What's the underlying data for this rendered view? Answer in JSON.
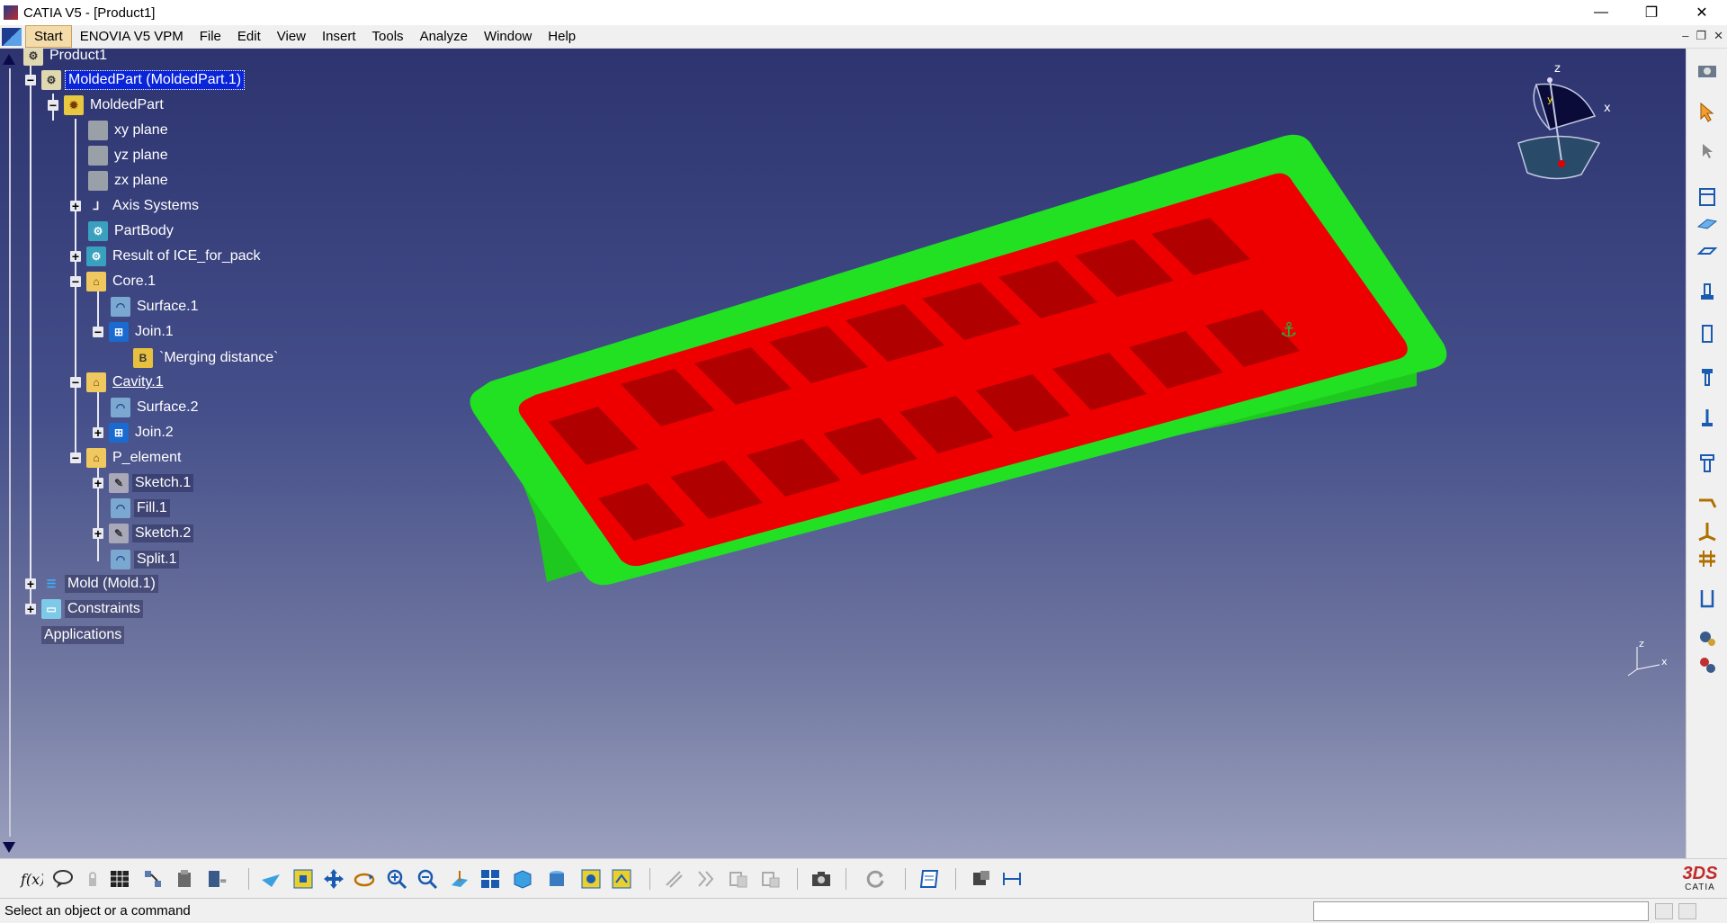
{
  "window": {
    "title": "CATIA V5 - [Product1]",
    "controls": {
      "minimize": "—",
      "maximize": "❐",
      "close": "✕"
    }
  },
  "menubar": {
    "items": [
      "Start",
      "ENOVIA V5 VPM",
      "File",
      "Edit",
      "View",
      "Insert",
      "Tools",
      "Analyze",
      "Window",
      "Help"
    ],
    "mdi_controls": {
      "minimize": "–",
      "restore": "❐",
      "close": "✕"
    }
  },
  "tree": {
    "root": "Product1",
    "molded_part_instance": "MoldedPart (MoldedPart.1)",
    "molded_part": "MoldedPart",
    "xy_plane": "xy plane",
    "yz_plane": "yz plane",
    "zx_plane": "zx plane",
    "axis_systems": "Axis Systems",
    "part_body": "PartBody",
    "result_ice": "Result of ICE_for_pack",
    "core": "Core.1",
    "surface1": "Surface.1",
    "join1": "Join.1",
    "merging_distance": "`Merging distance`",
    "cavity": "Cavity.1",
    "surface2": "Surface.2",
    "join2": "Join.2",
    "p_element": "P_element",
    "sketch1": "Sketch.1",
    "fill1": "Fill.1",
    "sketch2": "Sketch.2",
    "split1": "Split.1",
    "mold": "Mold (Mold.1)",
    "constraints": "Constraints",
    "applications": "Applications"
  },
  "compass": {
    "x_label": "x",
    "y_label": "y",
    "z_label": "z"
  },
  "triad": {
    "x_label": "x",
    "z_label": "z"
  },
  "logo": {
    "text": "CATIA",
    "mark": "3DS"
  },
  "statusbar": {
    "message": "Select an object or a command",
    "command_input": ""
  },
  "colors": {
    "viewport_top": "#2d3470",
    "viewport_bottom": "#9aa0bd",
    "core_green": "#22e022",
    "cavity_red": "#ee0000",
    "selection_blue": "#0a24d8"
  },
  "icons": {
    "bottom_toolbar": [
      "formula-icon",
      "knowledge-advisor-icon",
      "lock-icon",
      "grid-icon",
      "catalog-icon",
      "library-icon",
      "measure-param-icon",
      "fly-mode-icon",
      "fit-all-icon",
      "pan-icon",
      "rotate-icon",
      "zoom-in-icon",
      "zoom-out-icon",
      "normal-view-icon",
      "multi-view-icon",
      "iso-view-icon",
      "shading-icon",
      "hide-show-icon",
      "swap-space-icon",
      "cut-icon",
      "jump-icon",
      "edit-icon",
      "paste-icon",
      "capture-icon",
      "update-icon",
      "publication-icon",
      "save-management-icon",
      "measure-between-icon"
    ],
    "right_toolbar": [
      "camera-icon",
      "select-arrow-icon",
      "snap-icon",
      "mold-base-icon",
      "plate-icon",
      "insert-icon",
      "locating-ring-icon",
      "rectangle-icon",
      "bolt-icon",
      "pin-icon",
      "leader-pin-icon",
      "angle-icon",
      "ejector-icon",
      "coolant-icon",
      "bracket-icon",
      "gear-settings-icon",
      "tools-icon"
    ]
  }
}
